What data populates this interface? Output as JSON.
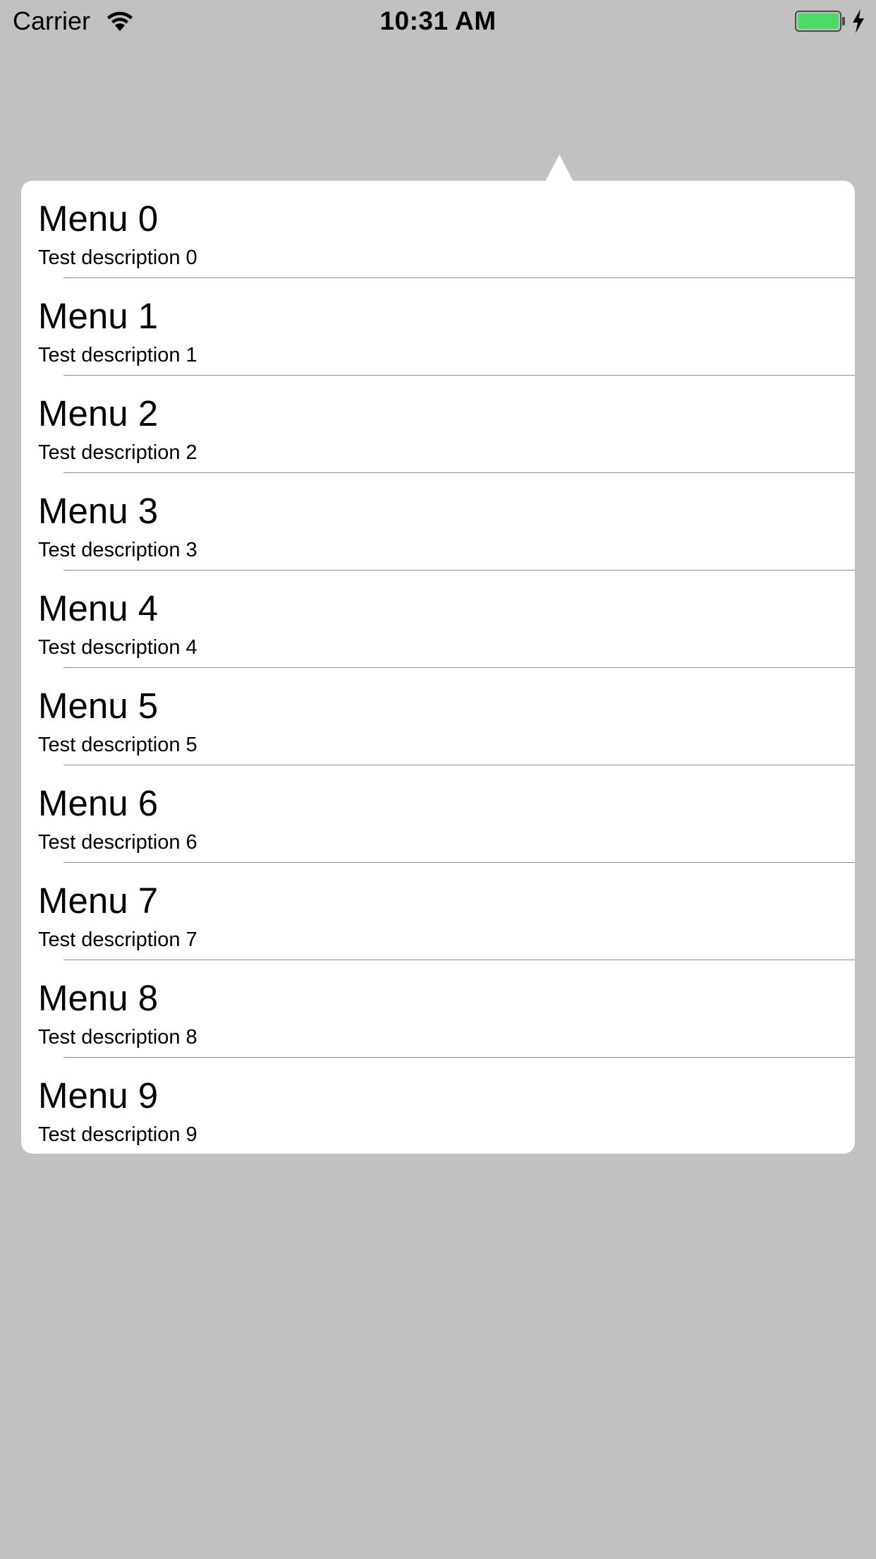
{
  "status_bar": {
    "carrier": "Carrier",
    "time": "10:31 AM",
    "wifi_icon": "wifi-icon",
    "battery_icon": "battery-icon",
    "battery_level": 1.0,
    "battery_color": "#4cd964",
    "charging_icon": "lightning-bolt-icon"
  },
  "popover": {
    "background_color": "#ffffff",
    "overlay_color": "#c1c1c1",
    "items": [
      {
        "title": "Menu 0",
        "description": "Test description 0"
      },
      {
        "title": "Menu 1",
        "description": "Test description 1"
      },
      {
        "title": "Menu 2",
        "description": "Test description 2"
      },
      {
        "title": "Menu 3",
        "description": "Test description 3"
      },
      {
        "title": "Menu 4",
        "description": "Test description 4"
      },
      {
        "title": "Menu 5",
        "description": "Test description 5"
      },
      {
        "title": "Menu 6",
        "description": "Test description 6"
      },
      {
        "title": "Menu 7",
        "description": "Test description 7"
      },
      {
        "title": "Menu 8",
        "description": "Test description 8"
      },
      {
        "title": "Menu 9",
        "description": "Test description 9"
      }
    ]
  }
}
